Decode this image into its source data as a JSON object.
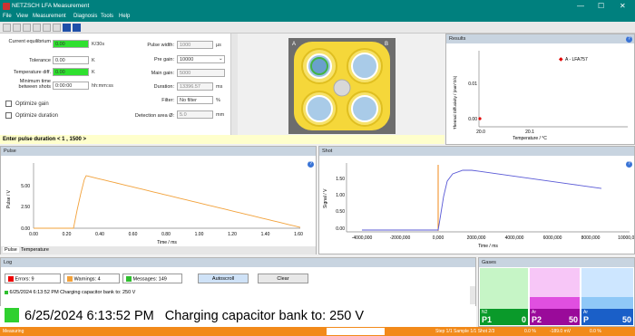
{
  "window": {
    "title": "NETZSCH LFA Measurement"
  },
  "menu": [
    "File",
    "View",
    "Measurement",
    "Diagnosis",
    "Tools",
    "Help"
  ],
  "settings": {
    "current_label": "Current equilibrium",
    "current_value": "0.00",
    "current_unit": "K/30s",
    "tolerance_label": "Tolerance",
    "tolerance_value": "0.00",
    "tolerance_unit": "K",
    "tempdiff_label": "Temperature diff.",
    "tempdiff_value": "0.00",
    "tempdiff_unit": "K",
    "mintime_label": "Minimum time between shots",
    "mintime_value": "0:00:00",
    "mintime_unit": "hh:mm:ss",
    "opt_gain": "Optimize gain",
    "opt_duration": "Optimize duration",
    "pulse_width_label": "Pulse width:",
    "pulse_width_value": "1000",
    "pulse_width_unit": "µs",
    "pregain_label": "Pre gain:",
    "pregain_value": "10000",
    "maingain_label": "Main gain:",
    "maingain_value": "5000",
    "duration_label": "Duration:",
    "duration_value": "13396.57",
    "duration_unit": "ms",
    "filter_label": "Filter:",
    "filter_value": "No filter",
    "filter_unit": "%",
    "detection_label": "Detection area Ø:",
    "detection_value": "5.0",
    "detection_unit": "mm"
  },
  "status": {
    "message": "Enter pulse duration < 1 , 1500 >"
  },
  "sample_holder": {
    "label_a": "A",
    "label_b": "B"
  },
  "results": {
    "title": "Results",
    "ylabel": "Thermal Diffusivity / (mm^2/s)",
    "xlabel": "Temperature / °C",
    "legend": "A - LFA757",
    "yticks": [
      "0.01",
      "0.00"
    ],
    "xticks": [
      "20.0",
      "20.1"
    ]
  },
  "pulse": {
    "title": "Pulse",
    "ylabel": "Pulse / V",
    "xlabel": "Time / ms",
    "yticks": [
      "5.00",
      "2.50",
      "0.00"
    ],
    "xticks": [
      "0.00",
      "0.20",
      "0.40",
      "0.60",
      "0.80",
      "1.00",
      "1.20",
      "1.40",
      "1.60"
    ],
    "tab_pulse": "Pulse",
    "tab_temperature": "Temperature"
  },
  "shot": {
    "title": "Shot",
    "ylabel": "Signal / V",
    "xlabel": "Time / ms",
    "yticks": [
      "1.50",
      "1.00",
      "0.50",
      "0.00"
    ],
    "xticks": [
      "-4000,000",
      "-2000,000",
      "0,000",
      "2000,000",
      "4000,000",
      "6000,000",
      "8000,000",
      "10000,000"
    ]
  },
  "log": {
    "title": "Log",
    "errors": "Errors: 9",
    "warnings": "Warnings: 4",
    "messages": "Messages: 149",
    "autoscroll": "Autoscroll",
    "clear": "Clear",
    "entry": "6/25/2024 6:13:52 PM   Charging capacitor bank to: 250 V",
    "big_timestamp": "6/25/2024 6:13:52 PM",
    "big_message": "Charging capacitor bank to: 250 V"
  },
  "gases": {
    "title": "Gases",
    "items": [
      {
        "name": "N2",
        "label": "P1",
        "value": "0"
      },
      {
        "name": "Ar",
        "label": "P2",
        "value": "50"
      },
      {
        "name": "Ar",
        "label": "P",
        "value": "50"
      }
    ]
  },
  "statusbar": {
    "left": "Measuring",
    "seg1": "Step 1/1  Sample 1/1  Shot 2/3",
    "seg2": "0.0 %",
    "seg3": "-189.0 mV",
    "seg4": "0.0 %"
  },
  "colors": {
    "accent": "#00807e",
    "green": "#2fe02f",
    "orange": "#f28a1a",
    "holder": "#f5d73a"
  }
}
